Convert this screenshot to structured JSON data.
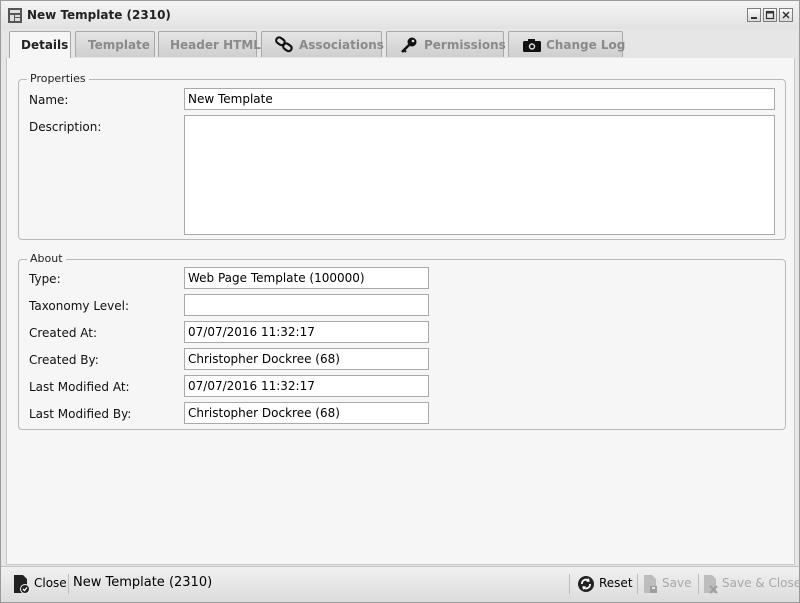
{
  "window": {
    "title": "New Template (2310)"
  },
  "tabs": [
    {
      "label": "Details",
      "active": true
    },
    {
      "label": "Template"
    },
    {
      "label": "Header HTML"
    },
    {
      "label": "Associations",
      "icon": "chain-link-icon"
    },
    {
      "label": "Permissions",
      "icon": "key-icon"
    },
    {
      "label": "Change Log",
      "icon": "camera-icon"
    }
  ],
  "properties": {
    "legend": "Properties",
    "name_label": "Name:",
    "name_value": "New Template",
    "description_label": "Description:",
    "description_value": ""
  },
  "about": {
    "legend": "About",
    "fields": [
      {
        "label": "Type:",
        "value": "Web Page Template (100000)"
      },
      {
        "label": "Taxonomy Level:",
        "value": ""
      },
      {
        "label": "Created At:",
        "value": "07/07/2016 11:32:17"
      },
      {
        "label": "Created By:",
        "value": "Christopher Dockree (68)"
      },
      {
        "label": "Last Modified At:",
        "value": "07/07/2016 11:32:17"
      },
      {
        "label": "Last Modified By:",
        "value": "Christopher Dockree (68)"
      }
    ]
  },
  "bottombar": {
    "close_label": "Close",
    "status_text": "New Template (2310)",
    "reset_label": "Reset",
    "save_label": "Save",
    "save_close_label": "Save & Close"
  }
}
